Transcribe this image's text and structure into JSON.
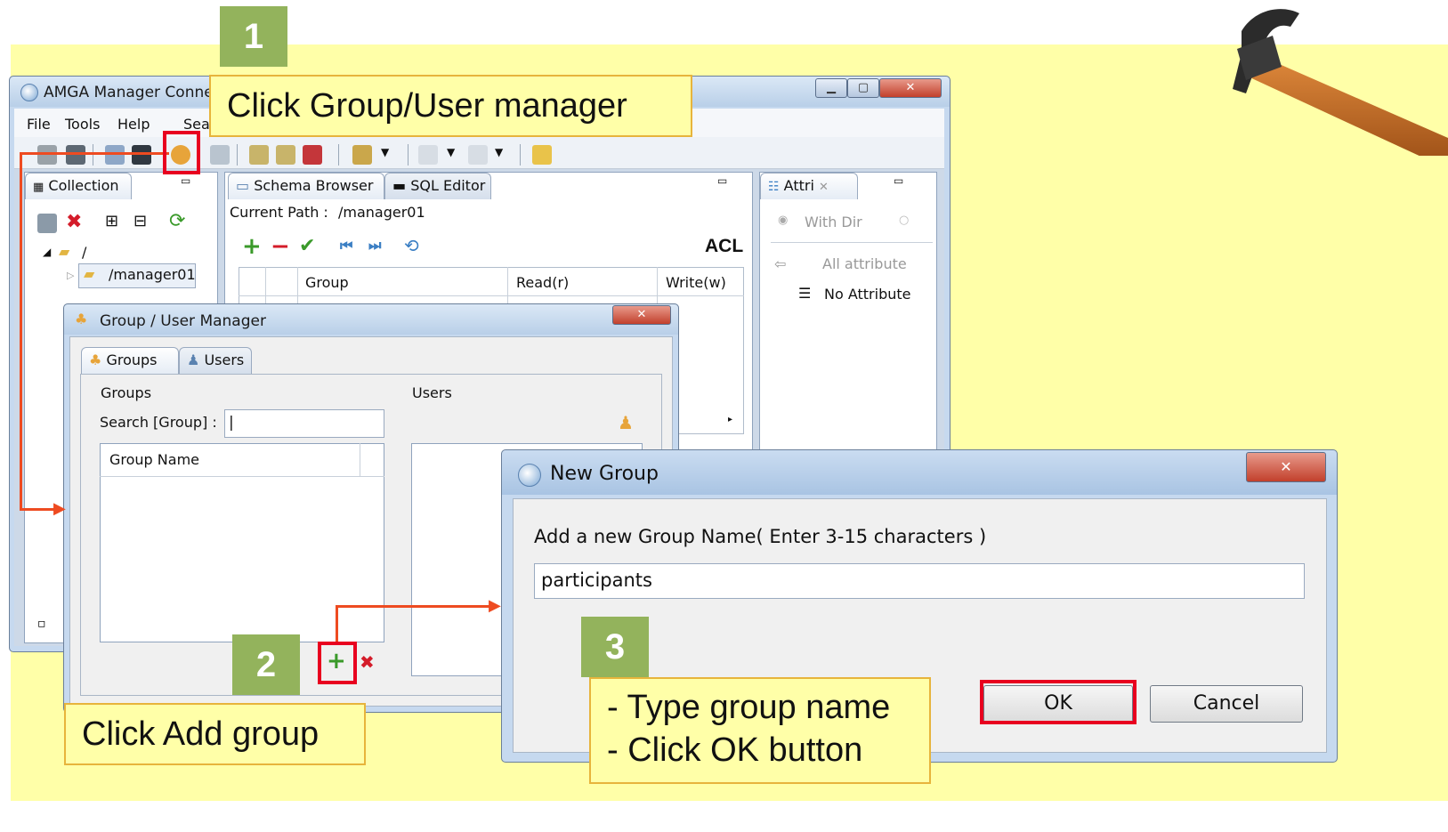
{
  "main_window": {
    "title": "AMGA Manager Connect",
    "menu": [
      "File",
      "Tools",
      "Help",
      "Sea"
    ],
    "collection_panel": {
      "tab_label": "Collection",
      "tree_root": "/",
      "tree_child": "/manager01"
    },
    "editor": {
      "tabs": [
        "Schema Browser",
        "SQL Editor"
      ],
      "current_path_label": "Current Path :",
      "current_path_value": "/manager01",
      "acl_label": "ACL",
      "columns": [
        "Group",
        "Read(r)",
        "Write(w)"
      ]
    },
    "attributes_panel": {
      "tab_label": "Attri",
      "radio_label": "With Dir",
      "filter_label": "All attribute",
      "empty_label": "No Attribute"
    }
  },
  "group_manager": {
    "title": "Group / User Manager",
    "tabs": [
      "Groups",
      "Users"
    ],
    "groups_section_label": "Groups",
    "users_section_label": "Users",
    "search_label": "Search [Group] :",
    "search_value": "|",
    "group_name_column": "Group Name"
  },
  "new_group_dialog": {
    "title": "New Group",
    "prompt": "Add a new Group Name( Enter 3-15 characters )",
    "input_value": "participants",
    "ok_label": "OK",
    "cancel_label": "Cancel"
  },
  "annotations": {
    "step1_number": "1",
    "step1_text": "Click Group/User manager",
    "step2_number": "2",
    "step2_text": "Click Add group",
    "step3_number": "3",
    "step3_line1": "- Type group name",
    "step3_line2": "- Click OK button"
  },
  "colors": {
    "background": "#ffffa8",
    "step_badge": "#93b35c",
    "highlight": "#e8001f",
    "arrow": "#ee4b21",
    "callout_border": "#e7b43c"
  }
}
